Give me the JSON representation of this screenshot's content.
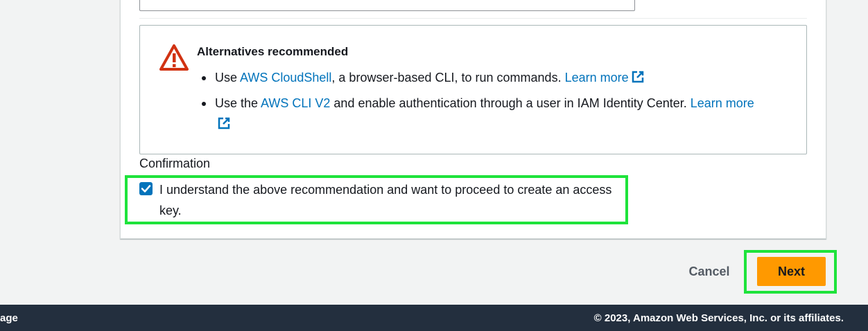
{
  "alert": {
    "title": "Alternatives recommended",
    "item1": {
      "prefix": "Use ",
      "link": "AWS CloudShell",
      "middle": ", a browser-based CLI, to run commands. ",
      "learn_more": "Learn more"
    },
    "item2": {
      "prefix": "Use the ",
      "link": "AWS CLI V2",
      "middle": " and enable authentication through a user in IAM Identity Center. ",
      "learn_more": "Learn more"
    }
  },
  "confirmation": {
    "label": "Confirmation",
    "checkbox_text": "I understand the above recommendation and want to proceed to create an access key.",
    "checked": true
  },
  "actions": {
    "cancel_label": "Cancel",
    "next_label": "Next"
  },
  "footer": {
    "left_text": "age",
    "copyright": "© 2023, Amazon Web Services, Inc. or its affiliates."
  },
  "colors": {
    "link": "#0073bb",
    "primary_button": "#ff9900",
    "footer_bg": "#232f3e",
    "warning": "#d13212",
    "highlight": "#1ee33b"
  }
}
